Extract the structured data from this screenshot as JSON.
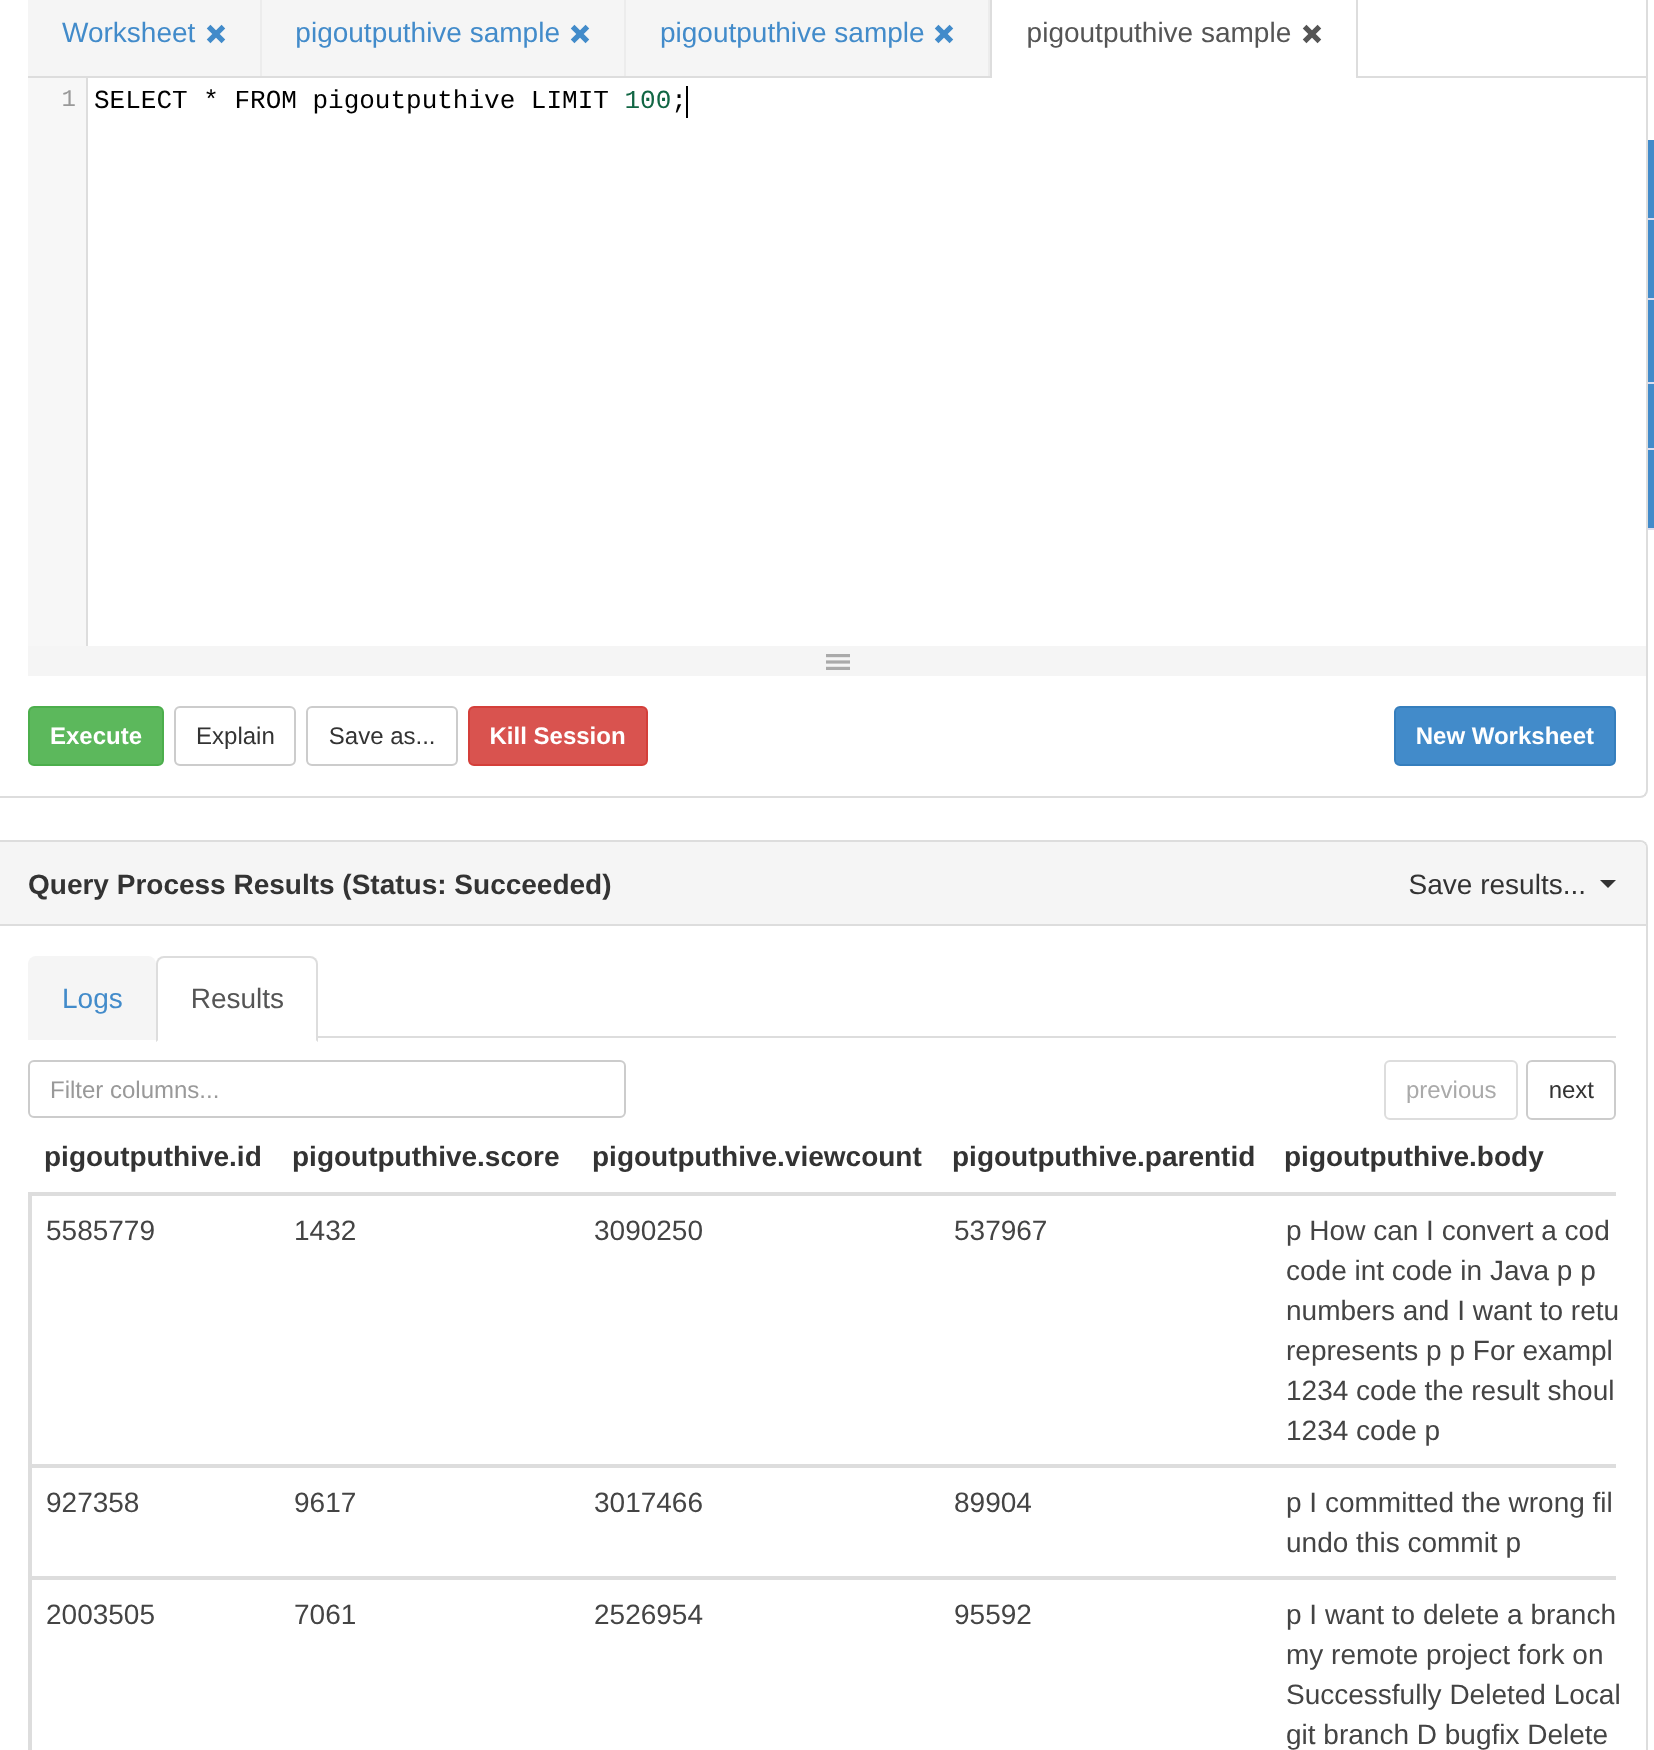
{
  "worksheet_tabs": [
    {
      "label": "Worksheet",
      "selected": false
    },
    {
      "label": "pigoutputhive sample",
      "selected": false
    },
    {
      "label": "pigoutputhive sample",
      "selected": false
    },
    {
      "label": "pigoutputhive sample",
      "selected": true
    }
  ],
  "editor": {
    "focused": true,
    "lines": [
      {
        "number": "1",
        "tokens": [
          {
            "text": "SELECT * FROM pigoutputhive LIMIT ",
            "kind": "plain"
          },
          {
            "text": "100",
            "kind": "number"
          },
          {
            "text": ";",
            "kind": "plain"
          }
        ]
      }
    ]
  },
  "toolbar": {
    "left": [
      {
        "label": "Execute",
        "kind": "success"
      },
      {
        "label": "Explain",
        "kind": "default"
      },
      {
        "label": "Save as...",
        "kind": "default"
      },
      {
        "label": "Kill Session",
        "kind": "danger"
      }
    ],
    "right": [
      {
        "label": "New Worksheet",
        "kind": "primary"
      }
    ]
  },
  "results": {
    "title": "Query Process Results (Status: Succeeded)",
    "save_menu": {
      "label": "Save results..."
    },
    "tabs": [
      {
        "label": "Logs",
        "selected": false
      },
      {
        "label": "Results",
        "selected": true
      }
    ],
    "filter": {
      "placeholder": "Filter columns..."
    },
    "pager": [
      {
        "label": "previous",
        "disabled": true
      },
      {
        "label": "next",
        "disabled": false
      }
    ],
    "table": {
      "columns": [
        "pigoutputhive.id",
        "pigoutputhive.score",
        "pigoutputhive.viewcount",
        "pigoutputhive.parentid",
        "pigoutputhive.body"
      ],
      "rows": [
        {
          "cells": [
            "5585779",
            "1432",
            "3090250",
            "537967",
            "p How can I convert a cod\ncode int code in Java p p\nnumbers and I want to retu\nrepresents p p For exampl\n1234 code the result shoul\n1234 code p"
          ]
        },
        {
          "cells": [
            "927358",
            "9617",
            "3017466",
            "89904",
            "p I committed the wrong fil\nundo this commit p"
          ]
        },
        {
          "cells": [
            "2003505",
            "7061",
            "2526954",
            "95592",
            "p I want to delete a branch\nmy remote project fork on\nSuccessfully Deleted Local\ngit branch D bugfix Delete"
          ]
        }
      ]
    }
  }
}
